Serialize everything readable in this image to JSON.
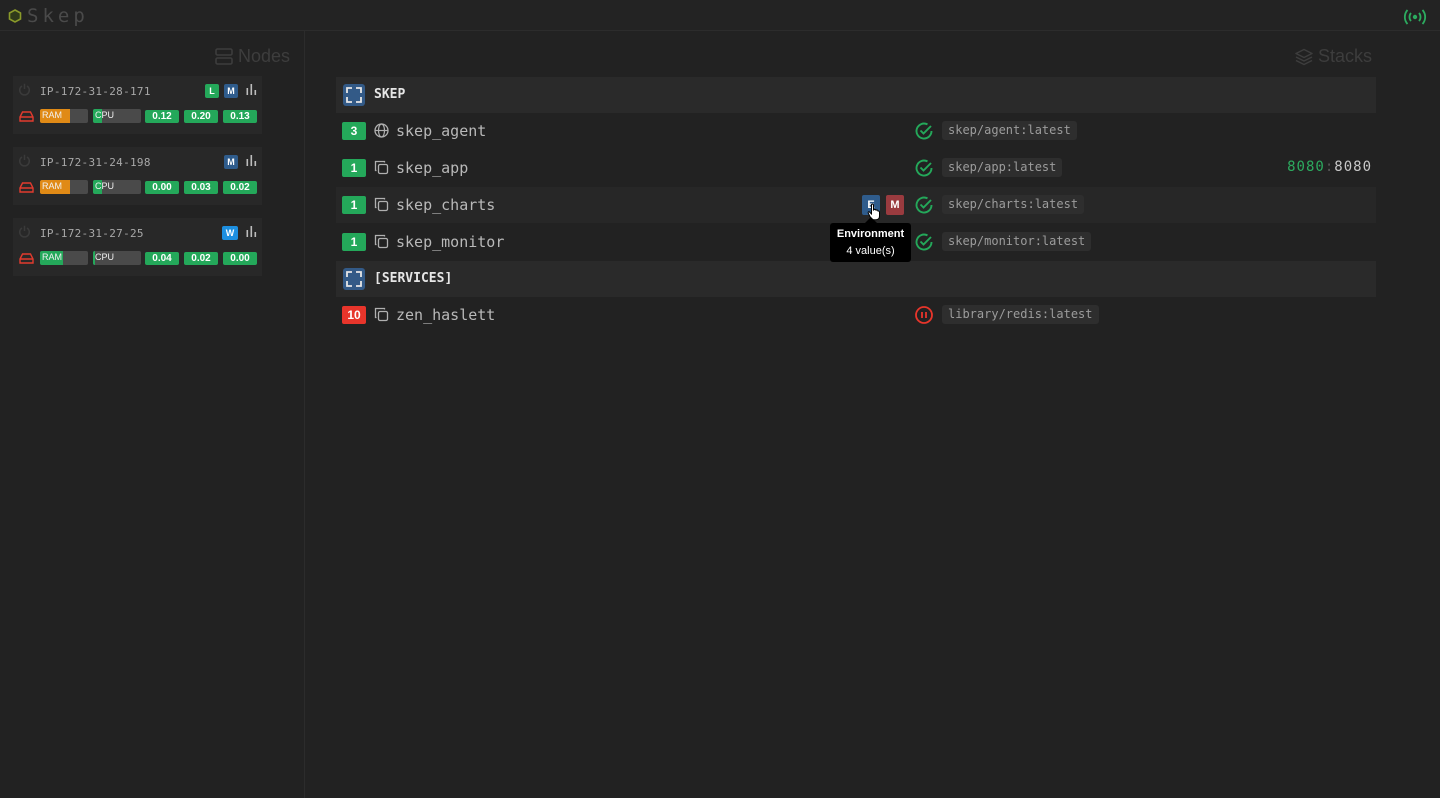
{
  "app": {
    "title": "Skep"
  },
  "nodes_panel": {
    "title": "Nodes",
    "nodes": [
      {
        "name": "IP-172-31-28-171",
        "badges": [
          "L",
          "M"
        ],
        "ram_label": "RAM",
        "ram_fraction": 0.62,
        "cpu_label": "CPU",
        "cpu_fraction": 0.18,
        "load": [
          "0.12",
          "0.20",
          "0.13"
        ]
      },
      {
        "name": "IP-172-31-24-198",
        "badges": [
          "M"
        ],
        "ram_label": "RAM",
        "ram_fraction": 0.62,
        "cpu_label": "CPU",
        "cpu_fraction": 0.18,
        "load": [
          "0.00",
          "0.03",
          "0.02"
        ]
      },
      {
        "name": "IP-172-31-27-25",
        "badges": [
          "W"
        ],
        "ram_label": "RAM",
        "ram_fraction": 0.48,
        "cpu_label": "CPU",
        "cpu_fraction": 0.05,
        "load": [
          "0.04",
          "0.02",
          "0.00"
        ]
      }
    ]
  },
  "stacks_panel": {
    "title": "Stacks",
    "groups": [
      {
        "name": "SKEP",
        "services": [
          {
            "replicas": "3",
            "kind": "global",
            "name": "skep_agent",
            "status": "running",
            "image": "skep/agent:latest"
          },
          {
            "replicas": "1",
            "kind": "replicated",
            "name": "skep_app",
            "status": "running",
            "image": "skep/app:latest",
            "port_published": "8080",
            "port_separator": ":",
            "port_target": "8080"
          },
          {
            "replicas": "1",
            "kind": "replicated",
            "name": "skep_charts",
            "status": "running",
            "image": "skep/charts:latest",
            "chips": [
              "E",
              "M"
            ]
          },
          {
            "replicas": "1",
            "kind": "replicated",
            "name": "skep_monitor",
            "status": "running",
            "image": "skep/monitor:latest"
          }
        ]
      },
      {
        "name": "[SERVICES]",
        "services": [
          {
            "replicas": "10",
            "kind": "replicated",
            "name": "zen_haslett",
            "status": "paused",
            "image": "library/redis:latest"
          }
        ]
      }
    ]
  },
  "tooltip": {
    "title": "Environment",
    "body": "4 value(s)"
  },
  "colors": {
    "background": "#222222",
    "ok_green": "#24a85a",
    "error_red": "#e8352b",
    "ram_orange": "#e08a16",
    "manager_blue": "#2f5c8c",
    "worker_blue": "#1d8fe0",
    "mount_red": "#9a3b3f"
  },
  "icons": {
    "logo": "hexagon-icon",
    "connection": "broadcast-icon",
    "nodes": "server-icon",
    "stacks": "layers-icon",
    "node_power": "power-icon",
    "node_disk": "disk-icon",
    "node_stats": "bar-chart-icon",
    "global_service": "globe-icon",
    "replicated_service": "copy-icon",
    "running": "check-circle-icon",
    "paused": "pause-circle-icon",
    "group": "expand-icon"
  }
}
